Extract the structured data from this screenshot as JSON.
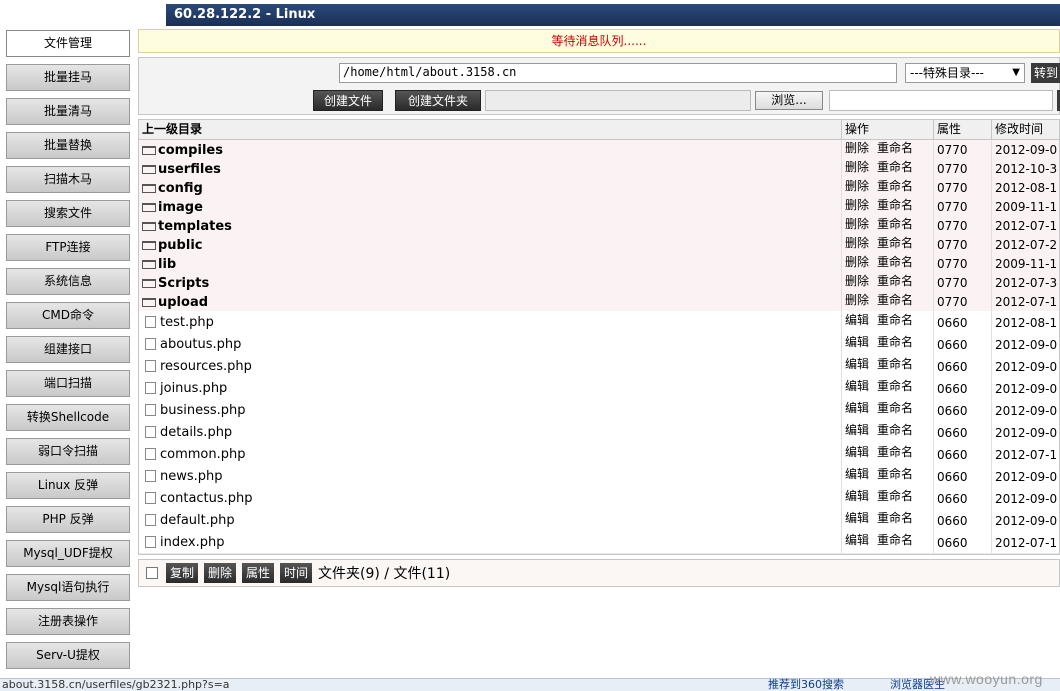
{
  "window": {
    "title": "60.28.122.2 - Linux"
  },
  "sidebar": {
    "items": [
      {
        "label": "文件管理",
        "active": true
      },
      {
        "label": "批量挂马"
      },
      {
        "label": "批量清马"
      },
      {
        "label": "批量替换"
      },
      {
        "label": "扫描木马"
      },
      {
        "label": "搜索文件"
      },
      {
        "label": "FTP连接"
      },
      {
        "label": "系统信息"
      },
      {
        "label": "CMD命令"
      },
      {
        "label": "组建接口"
      },
      {
        "label": "端口扫描"
      },
      {
        "label": "转换Shellcode"
      },
      {
        "label": "弱口令扫描"
      },
      {
        "label": "Linux 反弹"
      },
      {
        "label": "PHP 反弹"
      },
      {
        "label": "Mysql_UDF提权"
      },
      {
        "label": "Mysql语句执行"
      },
      {
        "label": "注册表操作"
      },
      {
        "label": "Serv-U提权"
      }
    ]
  },
  "message_bar": {
    "text": "等待消息队列......"
  },
  "toolbar": {
    "path": "/home/html/about.3158.cn",
    "special_dir_select": "---特殊目录---",
    "goto_label": "转到",
    "create_file_label": "创建文件",
    "create_folder_label": "创建文件夹",
    "browse_label": "浏览..."
  },
  "table": {
    "headers": {
      "name": "上一级目录",
      "ops": "操作",
      "attr": "属性",
      "time": "修改时间"
    },
    "dirs": [
      {
        "name": "compiles",
        "ops": [
          "删除",
          "重命名"
        ],
        "attr": "0770",
        "time": "2012-09-0"
      },
      {
        "name": "userfiles",
        "ops": [
          "删除",
          "重命名"
        ],
        "attr": "0770",
        "time": "2012-10-3"
      },
      {
        "name": "config",
        "ops": [
          "删除",
          "重命名"
        ],
        "attr": "0770",
        "time": "2012-08-1"
      },
      {
        "name": "image",
        "ops": [
          "删除",
          "重命名"
        ],
        "attr": "0770",
        "time": "2009-11-1"
      },
      {
        "name": "templates",
        "ops": [
          "删除",
          "重命名"
        ],
        "attr": "0770",
        "time": "2012-07-1"
      },
      {
        "name": "public",
        "ops": [
          "删除",
          "重命名"
        ],
        "attr": "0770",
        "time": "2012-07-2"
      },
      {
        "name": "lib",
        "ops": [
          "删除",
          "重命名"
        ],
        "attr": "0770",
        "time": "2009-11-1"
      },
      {
        "name": "Scripts",
        "ops": [
          "删除",
          "重命名"
        ],
        "attr": "0770",
        "time": "2012-07-3"
      },
      {
        "name": "upload",
        "ops": [
          "删除",
          "重命名"
        ],
        "attr": "0770",
        "time": "2012-07-1"
      }
    ],
    "files": [
      {
        "name": "test.php",
        "ops": [
          "编辑",
          "重命名"
        ],
        "attr": "0660",
        "time": "2012-08-1"
      },
      {
        "name": "aboutus.php",
        "ops": [
          "编辑",
          "重命名"
        ],
        "attr": "0660",
        "time": "2012-09-0"
      },
      {
        "name": "resources.php",
        "ops": [
          "编辑",
          "重命名"
        ],
        "attr": "0660",
        "time": "2012-09-0"
      },
      {
        "name": "joinus.php",
        "ops": [
          "编辑",
          "重命名"
        ],
        "attr": "0660",
        "time": "2012-09-0"
      },
      {
        "name": "business.php",
        "ops": [
          "编辑",
          "重命名"
        ],
        "attr": "0660",
        "time": "2012-09-0"
      },
      {
        "name": "details.php",
        "ops": [
          "编辑",
          "重命名"
        ],
        "attr": "0660",
        "time": "2012-09-0"
      },
      {
        "name": "common.php",
        "ops": [
          "编辑",
          "重命名"
        ],
        "attr": "0660",
        "time": "2012-07-1"
      },
      {
        "name": "news.php",
        "ops": [
          "编辑",
          "重命名"
        ],
        "attr": "0660",
        "time": "2012-09-0"
      },
      {
        "name": "contactus.php",
        "ops": [
          "编辑",
          "重命名"
        ],
        "attr": "0660",
        "time": "2012-09-0"
      },
      {
        "name": "default.php",
        "ops": [
          "编辑",
          "重命名"
        ],
        "attr": "0660",
        "time": "2012-09-0"
      },
      {
        "name": "index.php",
        "ops": [
          "编辑",
          "重命名"
        ],
        "attr": "0660",
        "time": "2012-07-1"
      }
    ]
  },
  "actions": {
    "copy": "复制",
    "delete": "删除",
    "attr": "属性",
    "time": "时间",
    "summary": "文件夹(9) / 文件(11)"
  },
  "statusbar": {
    "url": "about.3158.cn/userfiles/gb2321.php?s=a",
    "recommend": "推荐到360搜索",
    "speed": "浏览器医生"
  },
  "watermark": "www.wooyun.org"
}
